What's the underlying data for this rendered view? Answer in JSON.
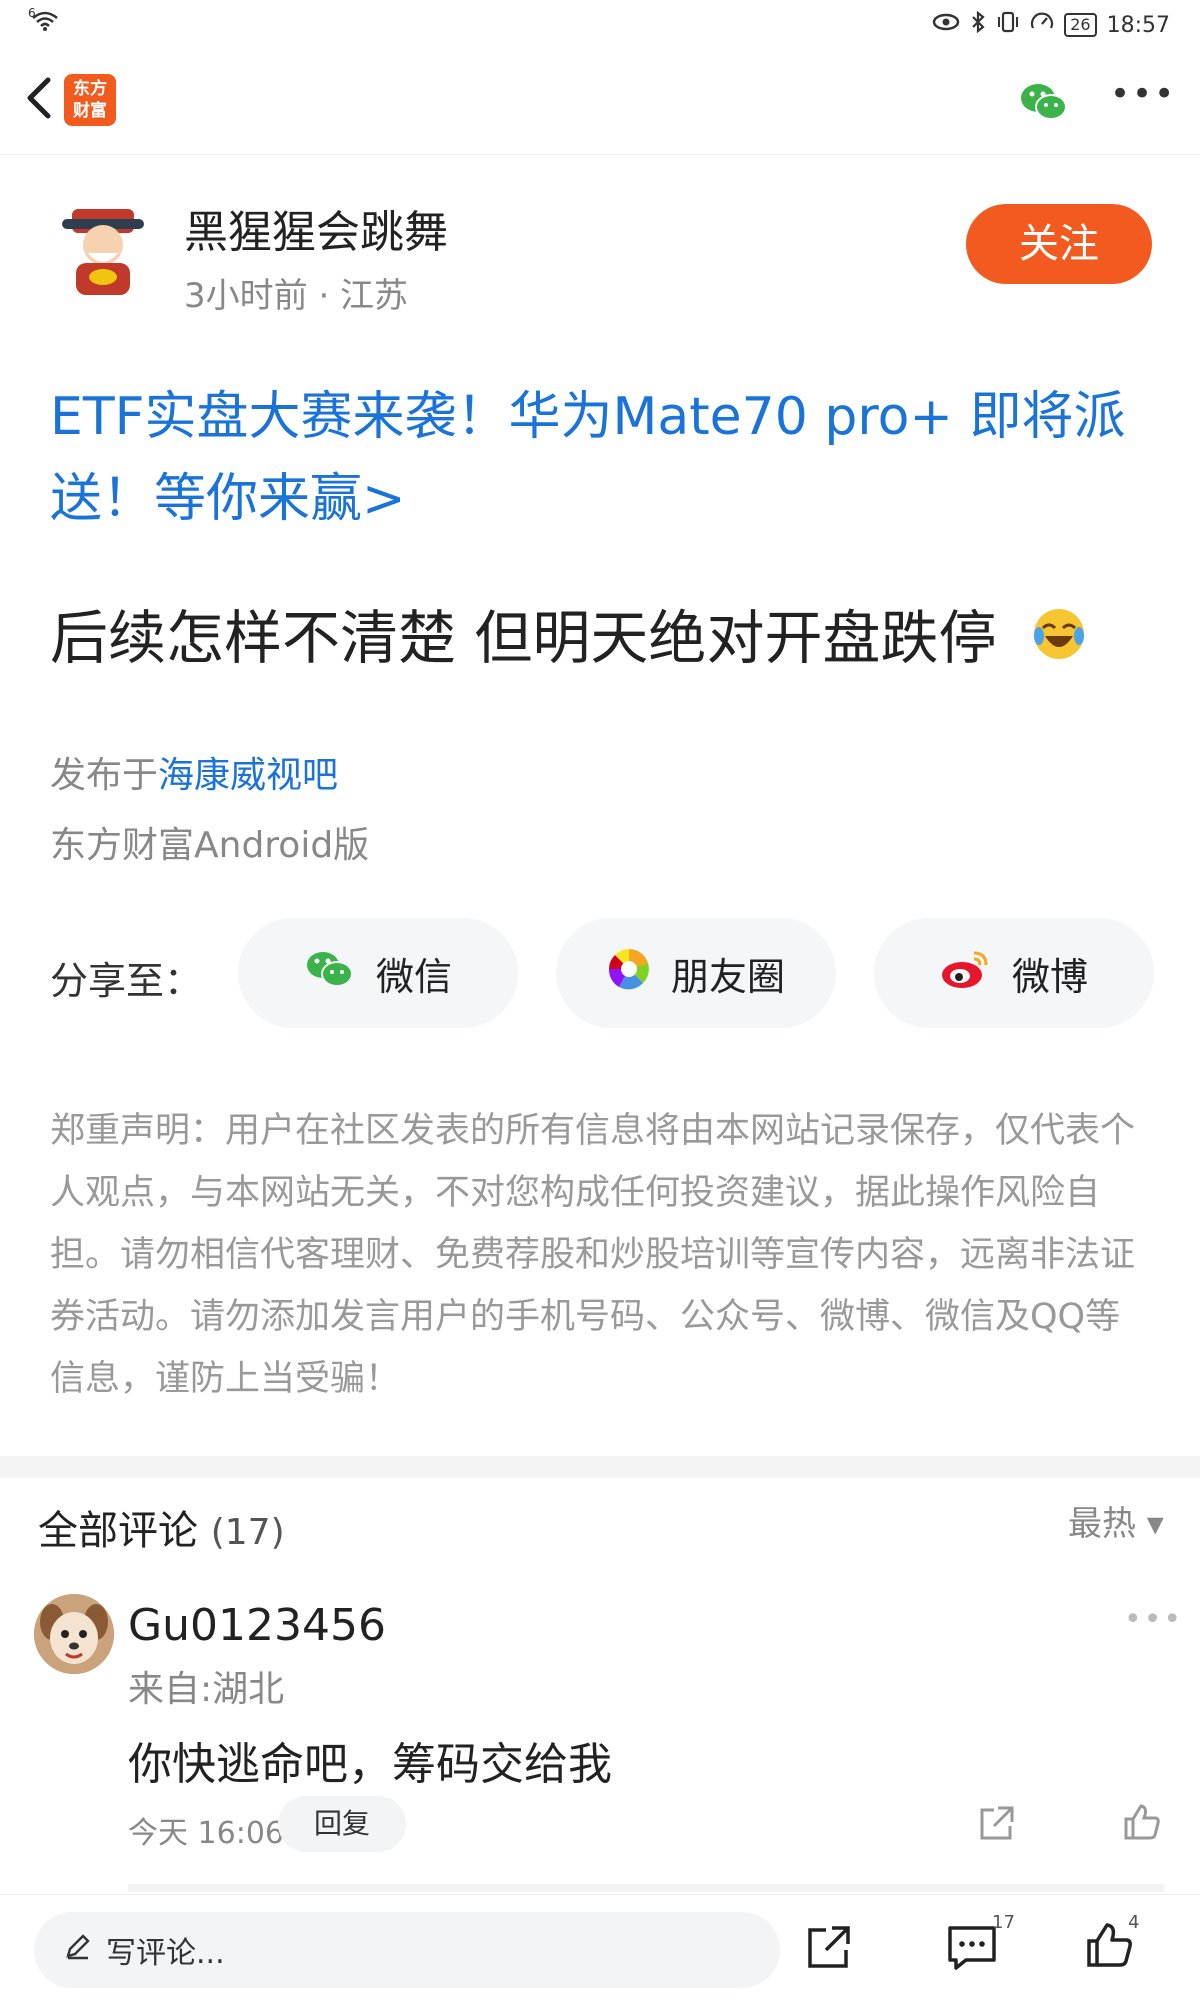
{
  "status_bar": {
    "left_label": "6",
    "battery": "26",
    "time": "18:57"
  },
  "nav": {
    "logo_line1": "东方",
    "logo_line2": "财富"
  },
  "author": {
    "name": "黑猩猩会跳舞",
    "meta": "3小时前 · 江苏",
    "follow_label": "关注"
  },
  "promo": {
    "text": "ETF实盘大赛来袭！华为Mate70 pro+ 即将派送！等你来赢>"
  },
  "post": {
    "text": "后续怎样不清楚 但明天绝对开盘跌停",
    "published_prefix": "发布于",
    "published_bar": "海康威视吧",
    "client": "东方财富Android版"
  },
  "share": {
    "label": "分享至：",
    "wechat": "微信",
    "moments": "朋友圈",
    "weibo": "微博"
  },
  "disclaimer": "郑重声明：用户在社区发表的所有信息将由本网站记录保存，仅代表个人观点，与本网站无关，不对您构成任何投资建议，据此操作风险自担。请勿相信代客理财、免费荐股和炒股培训等宣传内容，远离非法证券活动。请勿添加发言用户的手机号码、公众号、微博、微信及QQ等信息，谨防上当受骗！",
  "comments": {
    "title": "全部评论",
    "count": "(17)",
    "sort_label": "最热 ▾",
    "items": [
      {
        "user": "Gu0123456",
        "location": "来自:湖北",
        "text": "你快逃命吧，筹码交给我",
        "time": "今天 16:06",
        "reply_label": "回复"
      }
    ]
  },
  "bottom_bar": {
    "write_placeholder": "写评论...",
    "comment_count": "17",
    "like_count": "4"
  },
  "colors": {
    "brand": "#f35a1f",
    "link": "#1a73d9"
  }
}
